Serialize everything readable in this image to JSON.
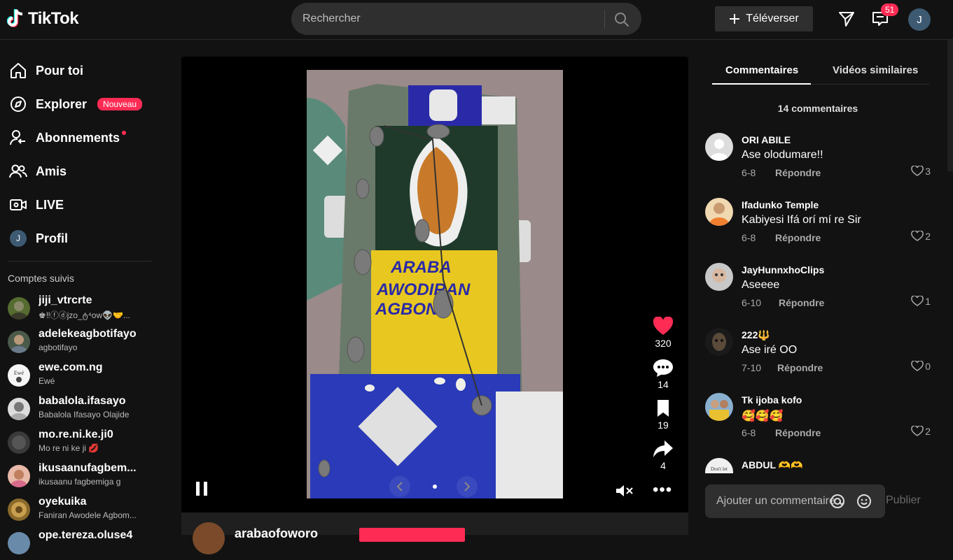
{
  "header": {
    "logo_text": "TikTok",
    "search_placeholder": "Rechercher",
    "upload_label": "Téléverser",
    "inbox_badge": "51",
    "avatar_letter": "J"
  },
  "sidenav": {
    "items": [
      {
        "label": "Pour toi"
      },
      {
        "label": "Explorer",
        "badge": "Nouveau"
      },
      {
        "label": "Abonnements"
      },
      {
        "label": "Amis"
      },
      {
        "label": "LIVE"
      },
      {
        "label": "Profil",
        "avatar_letter": "J"
      }
    ],
    "following_title": "Comptes suivis",
    "accounts": [
      {
        "name": "jiji_vtrcrte",
        "sub": "♚‼ⓕⓓjzo_ტ⁴ᴏᴡ👽🤝..."
      },
      {
        "name": "adelekeagbotifayo",
        "sub": "agbotifayo"
      },
      {
        "name": "ewe.com.ng",
        "sub": "Ewé"
      },
      {
        "name": "babalola.ifasayo",
        "sub": "Babalola Ifasayo Olajide"
      },
      {
        "name": "mo.re.ni.ke.ji0",
        "sub": "Mo re ni ke ji 💋"
      },
      {
        "name": "ikusaanufagbem...",
        "sub": "ikusaanu fagbemiga g"
      },
      {
        "name": "oyekuika",
        "sub": "Faniran Awodele Agbom..."
      },
      {
        "name": "ope.tereza.oluse4",
        "sub": ""
      }
    ]
  },
  "video": {
    "likes": "320",
    "comments": "14",
    "saves": "19",
    "shares": "4",
    "beadwork_text": [
      "ARABA",
      "AWODIRAN",
      "AGBONA"
    ],
    "author": "arabaofoworo"
  },
  "panel": {
    "tab_comments": "Commentaires",
    "tab_similar": "Vidéos similaires",
    "count_text": "14 commentaires",
    "reply_label": "Répondre",
    "comments": [
      {
        "user": "ORI ABILE",
        "text": "Ase olodumare!!",
        "date": "6-8",
        "likes": "3"
      },
      {
        "user": "Ifadunko Temple",
        "text": "Kabiyesi Ifá orí mí re Sir",
        "date": "6-8",
        "likes": "2"
      },
      {
        "user": "JayHunnxhoClips",
        "text": "Aseeee",
        "date": "6-10",
        "likes": "1"
      },
      {
        "user": "222🔱",
        "text": "Ase iré OO",
        "date": "7-10",
        "likes": "0"
      },
      {
        "user": "Tk ijoba kofo",
        "text": "🥰🥰🥰",
        "date": "6-8",
        "likes": "2"
      },
      {
        "user": "ABDUL 🫶🫶",
        "text": "",
        "date": "",
        "likes": ""
      }
    ],
    "input_placeholder": "Ajouter un commentaire...",
    "publish_label": "Publier"
  },
  "colors": {
    "accent": "#fe2c55",
    "background": "#121212"
  }
}
